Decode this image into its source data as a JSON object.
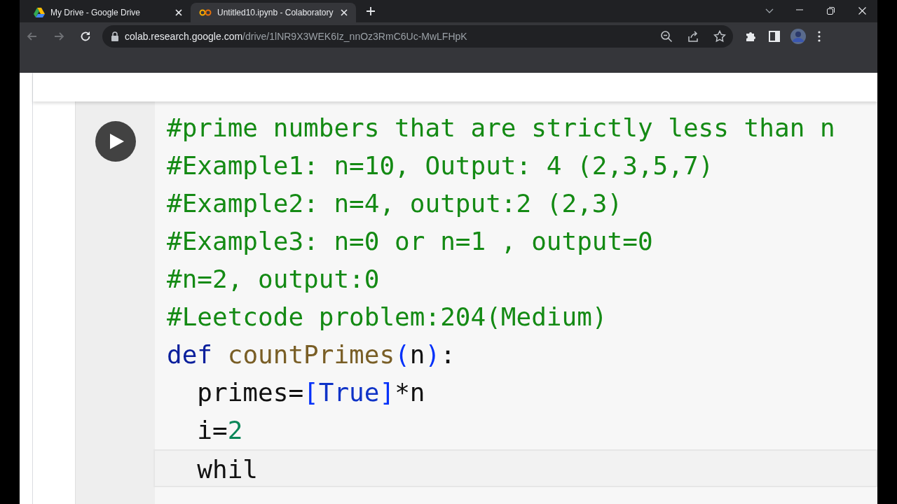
{
  "browser": {
    "tabs": [
      {
        "title": "My Drive - Google Drive",
        "kind": "drive",
        "selected": false
      },
      {
        "title": "Untitled10.ipynb - Colaboratory",
        "kind": "colab",
        "selected": true
      }
    ],
    "address": {
      "host": "colab.research.google.com",
      "path": "/drive/1lNR9X3WEK6Iz_nnOz3RmC6Uc-MwLFHpK"
    }
  },
  "cell": {
    "lines": [
      {
        "tokens": [
          {
            "kind": "comment",
            "text": "#prime numbers that are strictly less than n"
          }
        ]
      },
      {
        "tokens": [
          {
            "kind": "comment",
            "text": "#Example1: n=10, Output: 4 (2,3,5,7)"
          }
        ]
      },
      {
        "tokens": [
          {
            "kind": "comment",
            "text": "#Example2: n=4, output:2 (2,3)"
          }
        ]
      },
      {
        "tokens": [
          {
            "kind": "comment",
            "text": "#Example3: n=0 or n=1 , output=0"
          }
        ]
      },
      {
        "tokens": [
          {
            "kind": "comment",
            "text": "#n=2, output:0"
          }
        ]
      },
      {
        "tokens": [
          {
            "kind": "comment",
            "text": "#Leetcode problem:204(Medium)"
          }
        ]
      },
      {
        "tokens": [
          {
            "kind": "keyword",
            "text": "def "
          },
          {
            "kind": "function",
            "text": "countPrimes"
          },
          {
            "kind": "bracket",
            "text": "("
          },
          {
            "kind": "plain",
            "text": "n"
          },
          {
            "kind": "bracket",
            "text": ")"
          },
          {
            "kind": "plain",
            "text": ":"
          }
        ]
      },
      {
        "tokens": [
          {
            "kind": "plain",
            "text": "  primes="
          },
          {
            "kind": "bracket",
            "text": "["
          },
          {
            "kind": "constant",
            "text": "True"
          },
          {
            "kind": "bracket",
            "text": "]"
          },
          {
            "kind": "plain",
            "text": "*n"
          }
        ]
      },
      {
        "tokens": [
          {
            "kind": "plain",
            "text": "  i="
          },
          {
            "kind": "number",
            "text": "2"
          }
        ]
      },
      {
        "tokens": [
          {
            "kind": "plain",
            "text": "  whil"
          }
        ],
        "current": true
      }
    ]
  }
}
